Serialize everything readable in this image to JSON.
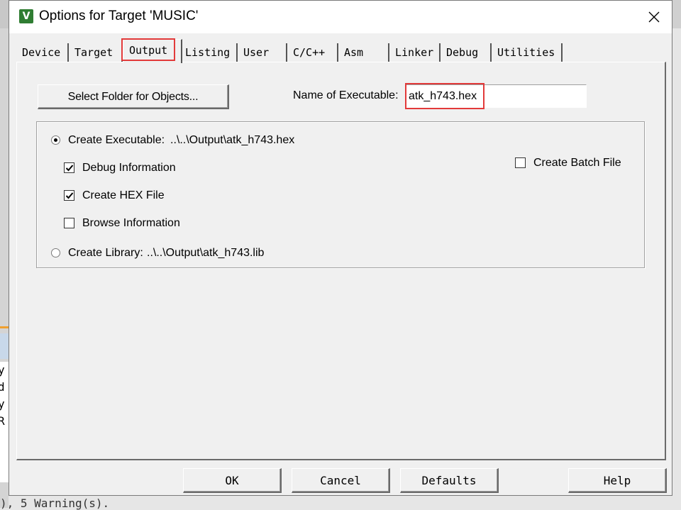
{
  "window": {
    "title": "Options for Target 'MUSIC'",
    "icon": "uvision-icon",
    "close_icon": "close-icon"
  },
  "tabs": [
    {
      "label": "Device",
      "active": false
    },
    {
      "label": "Target",
      "active": false
    },
    {
      "label": "Output",
      "active": true
    },
    {
      "label": "Listing",
      "active": false
    },
    {
      "label": "User",
      "active": false
    },
    {
      "label": "C/C++",
      "active": false
    },
    {
      "label": "Asm",
      "active": false
    },
    {
      "label": "Linker",
      "active": false
    },
    {
      "label": "Debug",
      "active": false
    },
    {
      "label": "Utilities",
      "active": false
    }
  ],
  "output": {
    "select_folder_label": "Select Folder for Objects...",
    "name_label": "Name of Executable:",
    "name_value": "atk_h743.hex",
    "create_executable": {
      "label": "Create Executable:",
      "path": "..\\..\\Output\\atk_h743.hex",
      "selected": true
    },
    "debug_info": {
      "label": "Debug Information",
      "checked": true
    },
    "create_hex": {
      "label": "Create HEX File",
      "checked": true
    },
    "browse_info": {
      "label": "Browse Information",
      "checked": false
    },
    "create_library": {
      "label": "Create Library:",
      "path": "..\\..\\Output\\atk_h743.lib",
      "selected": false
    },
    "create_batch": {
      "label": "Create Batch File",
      "checked": false
    }
  },
  "buttons": {
    "ok": "OK",
    "cancel": "Cancel",
    "defaults": "Defaults",
    "help": "Help"
  },
  "background": {
    "console_lines": [
      "y",
      "d",
      "y",
      "",
      "",
      "R"
    ],
    "console_bottom": "), 5 Warning(s)."
  },
  "colors": {
    "highlight": "#e23a3a",
    "dialog_bg": "#f0f0f0",
    "icon_green": "#2f7d32"
  }
}
